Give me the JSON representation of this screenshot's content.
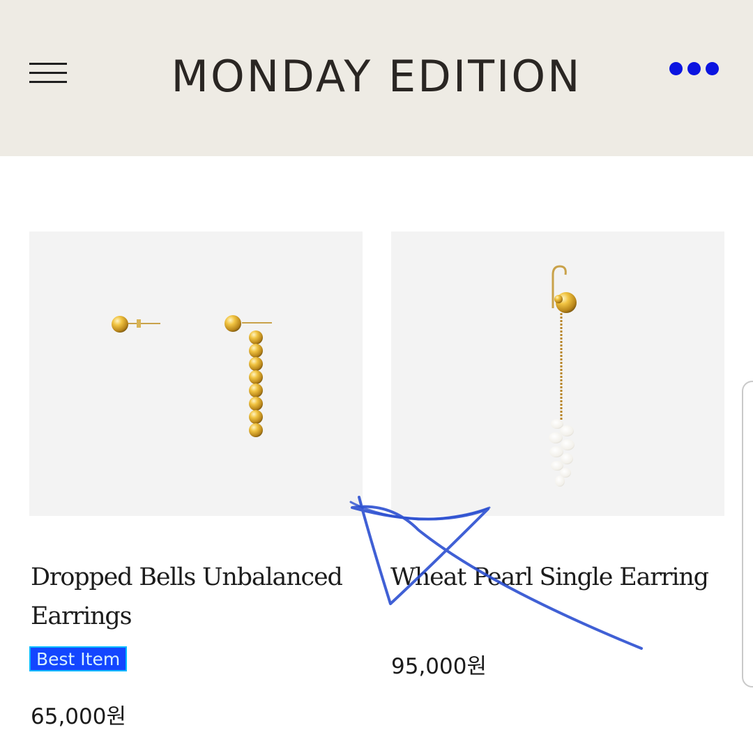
{
  "header": {
    "brand": "MONDAY EDITION",
    "menu_icon": "hamburger-menu-icon",
    "more_icon": "more-dots-icon",
    "more_color": "#0b14e0",
    "background": "#eeebe4"
  },
  "products": [
    {
      "name": "Dropped Bells Unbalanced Earrings",
      "badge": "Best Item",
      "price": "65,000원",
      "image": "gold-ball-drop-earrings"
    },
    {
      "name": "Wheat Pearl Single Earring",
      "price": "95,000원",
      "image": "pearl-wheat-drop-earring"
    }
  ],
  "annotation": {
    "type": "hand-drawn-scribble",
    "color": "#2b4fd0"
  },
  "colors": {
    "badge_bg": "#1346ff",
    "badge_text": "#d6f0ff"
  }
}
